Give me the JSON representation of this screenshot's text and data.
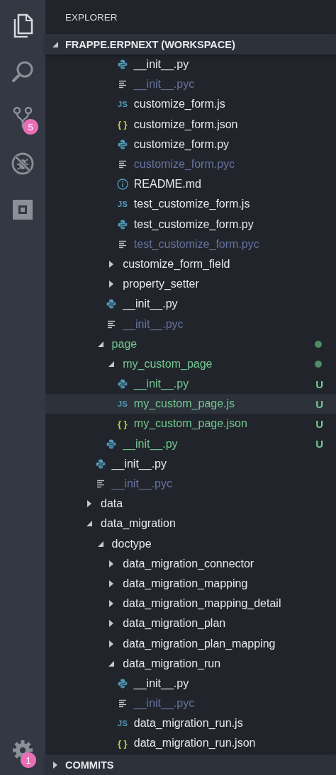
{
  "activity_bar": {
    "items": [
      {
        "kind": "files",
        "selected": true
      },
      {
        "kind": "search",
        "selected": false
      },
      {
        "kind": "source-control",
        "selected": false,
        "badge": "5"
      },
      {
        "kind": "debug",
        "selected": false
      },
      {
        "kind": "extensions",
        "selected": false
      }
    ],
    "settings_badge": "1"
  },
  "sidebar": {
    "title": "EXPLORER",
    "workspace": {
      "label": "FRAPPE.ERPNEXT (WORKSPACE)",
      "expanded": true
    },
    "tree": [
      {
        "children": [
          {
            "children": [
              {
                "children": [
                  {
                    "kind": "py",
                    "name": "__init__.py",
                    "ignored": false,
                    "untracked": false
                  },
                  {
                    "kind": "pyc",
                    "name": "__init__.pyc",
                    "ignored": true,
                    "untracked": false
                  },
                  {
                    "kind": "js",
                    "icon": "JS",
                    "name": "customize_form.js",
                    "ignored": false,
                    "untracked": false
                  },
                  {
                    "kind": "json",
                    "icon": "{ }",
                    "name": "customize_form.json",
                    "ignored": false,
                    "untracked": false
                  },
                  {
                    "kind": "py",
                    "name": "customize_form.py",
                    "ignored": false,
                    "untracked": false
                  },
                  {
                    "kind": "pyc",
                    "name": "customize_form.pyc",
                    "ignored": true,
                    "untracked": false
                  },
                  {
                    "kind": "md",
                    "name": "README.md",
                    "ignored": false,
                    "untracked": false
                  },
                  {
                    "kind": "js",
                    "icon": "JS",
                    "name": "test_customize_form.js",
                    "ignored": false,
                    "untracked": false
                  },
                  {
                    "kind": "py",
                    "name": "test_customize_form.py",
                    "ignored": false,
                    "untracked": false
                  },
                  {
                    "kind": "pyc",
                    "name": "test_customize_form.pyc",
                    "ignored": true,
                    "untracked": false
                  }
                ]
              },
              {
                "kind": "folder",
                "name": "customize_form_field",
                "expanded": false,
                "ignored": false,
                "untracked": false
              },
              {
                "kind": "folder",
                "name": "property_setter",
                "expanded": false,
                "ignored": false,
                "untracked": false
              },
              {
                "kind": "py",
                "name": "__init__.py",
                "ignored": false,
                "untracked": false
              },
              {
                "kind": "pyc",
                "name": "__init__.pyc",
                "ignored": true,
                "untracked": false
              }
            ]
          },
          {
            "kind": "folder",
            "name": "page",
            "expanded": true,
            "ignored": false,
            "untracked": true,
            "children": [
              {
                "kind": "folder",
                "name": "my_custom_page",
                "expanded": true,
                "ignored": false,
                "untracked": true,
                "children": [
                  {
                    "kind": "py",
                    "name": "__init__.py",
                    "ignored": false,
                    "untracked": true,
                    "badge": "U",
                    "selected": false
                  },
                  {
                    "kind": "js",
                    "icon": "JS",
                    "name": "my_custom_page.js",
                    "ignored": false,
                    "untracked": true,
                    "badge": "U",
                    "selected": true
                  },
                  {
                    "kind": "json",
                    "icon": "{ }",
                    "name": "my_custom_page.json",
                    "ignored": false,
                    "untracked": true,
                    "badge": "U",
                    "selected": false
                  }
                ]
              },
              {
                "kind": "py",
                "name": "__init__.py",
                "ignored": false,
                "untracked": true,
                "badge": "U"
              }
            ]
          },
          {
            "kind": "py",
            "name": "__init__.py",
            "ignored": false,
            "untracked": false
          },
          {
            "kind": "pyc",
            "name": "__init__.pyc",
            "ignored": true,
            "untracked": false
          }
        ]
      },
      {
        "kind": "folder",
        "name": "data",
        "expanded": false,
        "ignored": false,
        "untracked": false
      },
      {
        "kind": "folder",
        "name": "data_migration",
        "expanded": true,
        "ignored": false,
        "untracked": false,
        "children": [
          {
            "kind": "folder",
            "name": "doctype",
            "expanded": true,
            "ignored": false,
            "untracked": false,
            "children": [
              {
                "kind": "folder",
                "name": "data_migration_connector",
                "expanded": false,
                "ignored": false,
                "untracked": false
              },
              {
                "kind": "folder",
                "name": "data_migration_mapping",
                "expanded": false,
                "ignored": false,
                "untracked": false
              },
              {
                "kind": "folder",
                "name": "data_migration_mapping_detail",
                "expanded": false,
                "ignored": false,
                "untracked": false
              },
              {
                "kind": "folder",
                "name": "data_migration_plan",
                "expanded": false,
                "ignored": false,
                "untracked": false
              },
              {
                "kind": "folder",
                "name": "data_migration_plan_mapping",
                "expanded": false,
                "ignored": false,
                "untracked": false
              },
              {
                "kind": "folder",
                "name": "data_migration_run",
                "expanded": true,
                "ignored": false,
                "untracked": false,
                "children": [
                  {
                    "kind": "py",
                    "name": "__init__.py",
                    "ignored": false,
                    "untracked": false
                  },
                  {
                    "kind": "pyc",
                    "name": "__init__.pyc",
                    "ignored": true,
                    "untracked": false
                  },
                  {
                    "kind": "js",
                    "icon": "JS",
                    "name": "data_migration_run.js",
                    "ignored": false,
                    "untracked": false
                  },
                  {
                    "kind": "json",
                    "icon": "{ }",
                    "name": "data_migration_run.json",
                    "ignored": false,
                    "untracked": false
                  }
                ]
              }
            ]
          }
        ]
      }
    ],
    "commits": {
      "label": "COMMITS",
      "expanded": false
    }
  }
}
